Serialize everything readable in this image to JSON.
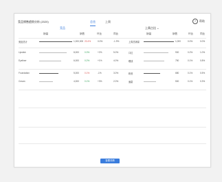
{
  "card": {
    "title": "竞品销售趋势分析 (2020)",
    "help_label": "帮助",
    "tabs": [
      "总览",
      "上周"
    ],
    "left_title": "竞品",
    "right_title": "上周占比",
    "headers_left": [
      "销量",
      "销售",
      "环比",
      "同比"
    ],
    "headers_right": [
      "销量",
      "销售",
      "环比",
      "同比"
    ]
  },
  "rows": [
    {
      "label": "竞品总计",
      "v1": "1,000,000",
      "v2": "20.4%",
      "v3": "0.0%",
      "v4": "-1.9%",
      "r1": "上周总销量",
      "r2": "1,000",
      "r3": "0.0%",
      "r4": "0.0%"
    },
    {
      "label": "Lipstick",
      "v1": "8,000",
      "v2": "0.3%",
      "v3": "+2%",
      "v4": "5.0%",
      "r1": "口红",
      "r2": "900",
      "r3": "0.2%",
      "r4": "1.0%"
    },
    {
      "label": "Eyeliner",
      "v1": "6,000",
      "v2": "0.2%",
      "v3": "+1%",
      "v4": "4.0%",
      "r1": "眼线",
      "r2": "750",
      "r3": "0.1%",
      "r4": "0.8%"
    },
    {
      "label": "Foundation",
      "v1": "5,000",
      "v2": "0.1%",
      "v3": "-1%",
      "v4": "3.0%",
      "r1": "粉底",
      "r2": "680",
      "r3": "0.1%",
      "r4": "0.5%"
    },
    {
      "label": "Cream",
      "v1": "4,000",
      "v2": "0.1%",
      "v3": "+3%",
      "v4": "2.0%",
      "r1": "面霜",
      "r2": "500",
      "r3": "0.1%",
      "r4": "0.3%"
    }
  ],
  "bottom_button": "查看详情"
}
